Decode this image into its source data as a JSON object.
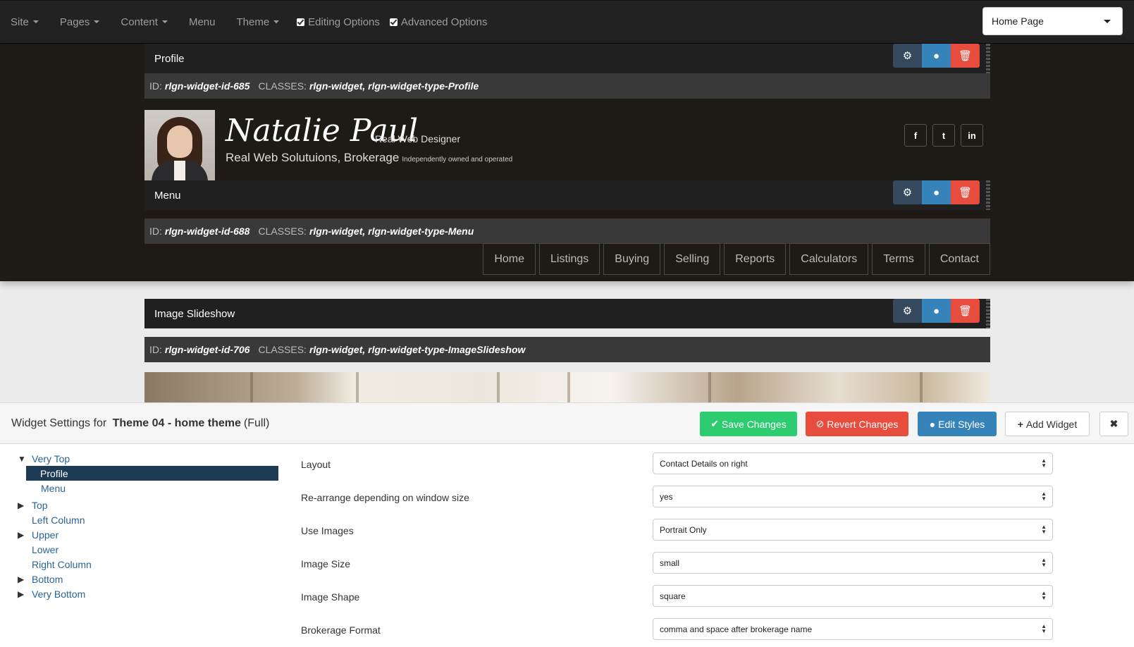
{
  "topnav": {
    "items": [
      {
        "label": "Site",
        "caret": true
      },
      {
        "label": "Pages",
        "caret": true
      },
      {
        "label": "Content",
        "caret": true
      },
      {
        "label": "Menu",
        "caret": false
      },
      {
        "label": "Theme",
        "caret": true
      }
    ],
    "editing_options": "Editing Options",
    "advanced_options": "Advanced Options",
    "page_select": "Home Page"
  },
  "widgets": {
    "profile": {
      "title": "Profile",
      "id_label": "ID:",
      "id_value": "rlgn-widget-id-685",
      "classes_label": "CLASSES:",
      "classes_value": "rlgn-widget, rlgn-widget-type-Profile"
    },
    "menu": {
      "title": "Menu",
      "id_label": "ID:",
      "id_value": "rlgn-widget-id-688",
      "classes_label": "CLASSES:",
      "classes_value": "rlgn-widget, rlgn-widget-type-Menu"
    },
    "slideshow": {
      "title": "Image Slideshow",
      "id_label": "ID:",
      "id_value": "rlgn-widget-id-706",
      "classes_label": "CLASSES:",
      "classes_value": "rlgn-widget, rlgn-widget-type-ImageSlideshow"
    }
  },
  "profile": {
    "name": "Natalie Paul",
    "title": "Real Web Designer",
    "brokerage": "Real Web Solutuions, Brokerage",
    "independent": "Independently owned and operated",
    "social": [
      "f",
      "t",
      "in"
    ]
  },
  "site_menu": [
    "Home",
    "Listings",
    "Buying",
    "Selling",
    "Reports",
    "Calculators",
    "Terms",
    "Contact"
  ],
  "settings": {
    "prefix": "Widget Settings for",
    "theme_name": "Theme 04 - home theme",
    "mode": "(Full)",
    "save": "Save Changes",
    "revert": "Revert Changes",
    "edit_styles": "Edit Styles",
    "add_widget": "Add Widget",
    "close": "✖",
    "tree": [
      {
        "label": "Very Top",
        "arrow": "▼"
      },
      {
        "label": "Profile",
        "selected": true
      },
      {
        "label": "Menu",
        "child": true
      },
      {
        "label": "Top",
        "arrow": "▶"
      },
      {
        "label": "Left Column",
        "arrow": ""
      },
      {
        "label": "Upper",
        "arrow": "▶"
      },
      {
        "label": "Lower",
        "arrow": ""
      },
      {
        "label": "Right Column",
        "arrow": ""
      },
      {
        "label": "Bottom",
        "arrow": "▶"
      },
      {
        "label": "Very Bottom",
        "arrow": "▶"
      }
    ],
    "fields": [
      {
        "label": "Layout",
        "value": "Contact Details on right"
      },
      {
        "label": "Re-arrange depending on window size",
        "value": "yes"
      },
      {
        "label": "Use Images",
        "value": "Portrait Only"
      },
      {
        "label": "Image Size",
        "value": "small"
      },
      {
        "label": "Image Shape",
        "value": "square"
      },
      {
        "label": "Brokerage Format",
        "value": "comma and space after brokerage name"
      }
    ]
  }
}
